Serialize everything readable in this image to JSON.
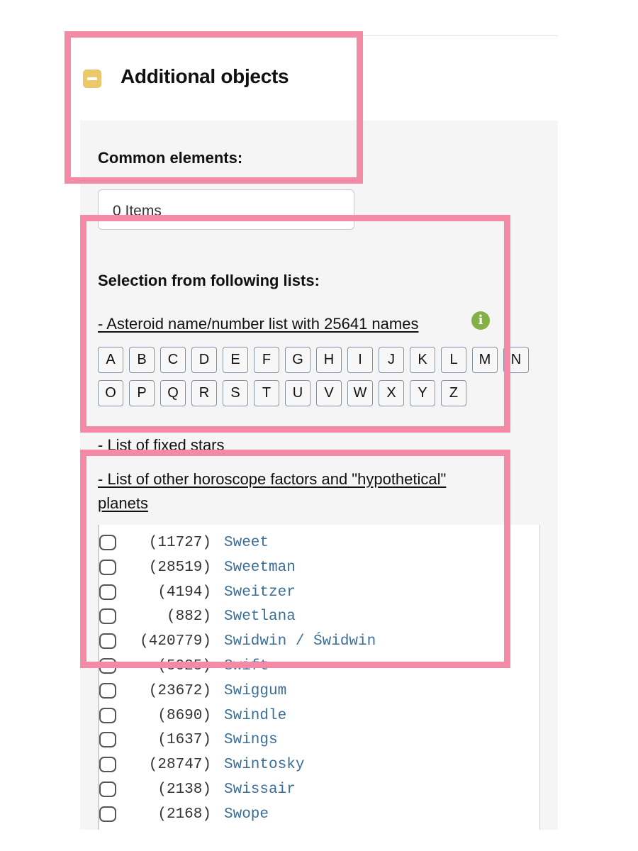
{
  "section": {
    "title": "Additional objects"
  },
  "common": {
    "label": "Common elements:",
    "items_value": "0 Items"
  },
  "selection": {
    "label": "Selection from following lists:",
    "asteroid_link": "- Asteroid name/number list with 25641 names",
    "info_icon": "i",
    "letters_row1": [
      "A",
      "B",
      "C",
      "D",
      "E",
      "F",
      "G",
      "H",
      "I",
      "J",
      "K",
      "L",
      "M",
      "N"
    ],
    "letters_row2": [
      "O",
      "P",
      "Q",
      "R",
      "S",
      "T",
      "U",
      "V",
      "W",
      "X",
      "Y",
      "Z"
    ],
    "fixed_stars_link": "- List of fixed stars",
    "other_factors_link_line1": "- List of other horoscope factors and \"hypothetical\"",
    "other_factors_link_line2": "planets"
  },
  "asteroids": [
    {
      "number": "(11727)",
      "name": "Sweet"
    },
    {
      "number": "(28519)",
      "name": "Sweetman"
    },
    {
      "number": "(4194)",
      "name": "Sweitzer"
    },
    {
      "number": "(882)",
      "name": "Swetlana"
    },
    {
      "number": "(420779)",
      "name": "Swidwin / Świdwin"
    },
    {
      "number": "(5025)",
      "name": "Swift"
    },
    {
      "number": "(23672)",
      "name": "Swiggum"
    },
    {
      "number": "(8690)",
      "name": "Swindle"
    },
    {
      "number": "(1637)",
      "name": "Swings"
    },
    {
      "number": "(28747)",
      "name": "Swintosky"
    },
    {
      "number": "(2138)",
      "name": "Swissair"
    },
    {
      "number": "(2168)",
      "name": "Swope"
    }
  ],
  "colors": {
    "highlight": "#f48aa5",
    "accent_yellow": "#ebc96a",
    "info_green": "#84b146",
    "link_blue": "#3b6e97"
  },
  "icons": {
    "collapse": "minus-square-icon",
    "info": "info-circle-icon"
  }
}
